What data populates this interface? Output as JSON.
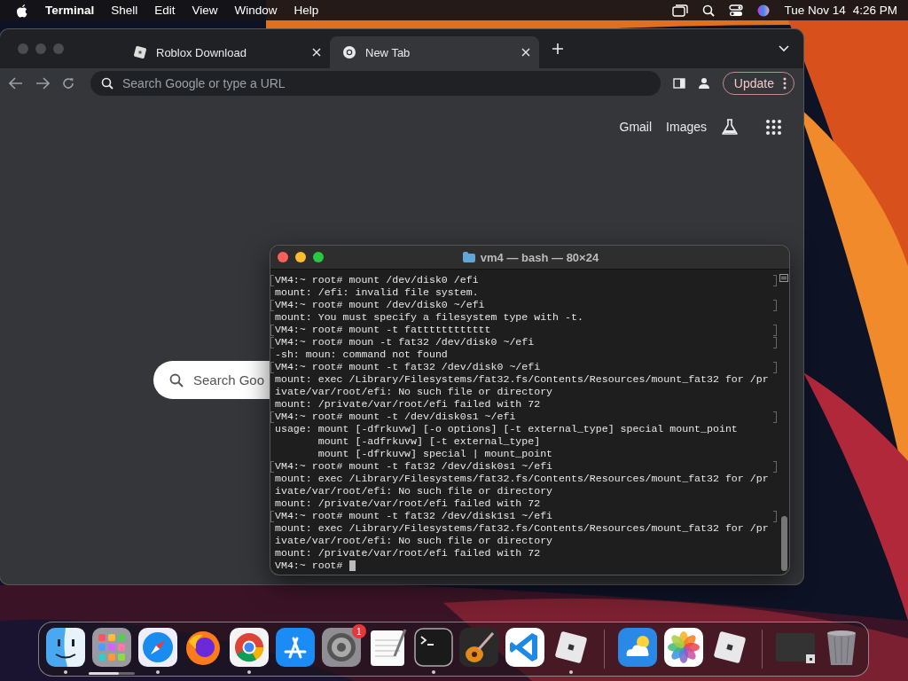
{
  "menu_bar": {
    "app": "Terminal",
    "items": [
      "Shell",
      "Edit",
      "View",
      "Window",
      "Help"
    ],
    "date": "Tue Nov 14",
    "time": "4:26 PM"
  },
  "browser": {
    "tabs": [
      {
        "label": "Roblox Download",
        "kind": "site",
        "selected": false
      },
      {
        "label": "New Tab",
        "kind": "newtab",
        "selected": true
      }
    ],
    "address_placeholder": "Search Google or type a URL",
    "update_button": "Update",
    "links": [
      "Gmail",
      "Images"
    ],
    "search_placeholder": "Search Goo"
  },
  "terminal": {
    "title": "vm4 — bash — 80×24",
    "lines": [
      {
        "kind": "command",
        "text": "VM4:~ root# mount /dev/disk0 /efi"
      },
      {
        "kind": "output",
        "text": "mount: /efi: invalid file system."
      },
      {
        "kind": "command",
        "text": "VM4:~ root# mount /dev/disk0 ~/efi"
      },
      {
        "kind": "output",
        "text": "mount: You must specify a filesystem type with -t."
      },
      {
        "kind": "command",
        "text": "VM4:~ root# mount -t fatttttttttttt"
      },
      {
        "kind": "command",
        "text": "VM4:~ root# moun -t fat32 /dev/disk0 ~/efi"
      },
      {
        "kind": "output",
        "text": "-sh: moun: command not found"
      },
      {
        "kind": "command",
        "text": "VM4:~ root# mount -t fat32 /dev/disk0 ~/efi"
      },
      {
        "kind": "output",
        "text": "mount: exec /Library/Filesystems/fat32.fs/Contents/Resources/mount_fat32 for /pr"
      },
      {
        "kind": "output",
        "text": "ivate/var/root/efi: No such file or directory"
      },
      {
        "kind": "output",
        "text": "mount: /private/var/root/efi failed with 72"
      },
      {
        "kind": "command",
        "text": "VM4:~ root# mount -t /dev/disk0s1 ~/efi"
      },
      {
        "kind": "output",
        "text": "usage: mount [-dfrkuvw] [-o options] [-t external_type] special mount_point"
      },
      {
        "kind": "output",
        "text": "       mount [-adfrkuvw] [-t external_type]"
      },
      {
        "kind": "output",
        "text": "       mount [-dfrkuvw] special | mount_point"
      },
      {
        "kind": "command",
        "text": "VM4:~ root# mount -t fat32 /dev/disk0s1 ~/efi"
      },
      {
        "kind": "output",
        "text": "mount: exec /Library/Filesystems/fat32.fs/Contents/Resources/mount_fat32 for /pr"
      },
      {
        "kind": "output",
        "text": "ivate/var/root/efi: No such file or directory"
      },
      {
        "kind": "output",
        "text": "mount: /private/var/root/efi failed with 72"
      },
      {
        "kind": "command",
        "text": "VM4:~ root# mount -t fat32 /dev/disk1s1 ~/efi"
      },
      {
        "kind": "output",
        "text": "mount: exec /Library/Filesystems/fat32.fs/Contents/Resources/mount_fat32 for /pr"
      },
      {
        "kind": "output",
        "text": "ivate/var/root/efi: No such file or directory"
      },
      {
        "kind": "output",
        "text": "mount: /private/var/root/efi failed with 72"
      },
      {
        "kind": "prompt",
        "text": "VM4:~ root#"
      }
    ]
  },
  "dock": {
    "items": [
      {
        "kind": "finder",
        "running": true
      },
      {
        "kind": "launchpad",
        "running": false,
        "level": 0.65
      },
      {
        "kind": "safari",
        "running": true
      },
      {
        "kind": "firefox",
        "running": false
      },
      {
        "kind": "chrome",
        "running": true
      },
      {
        "kind": "appstore",
        "running": false
      },
      {
        "kind": "settings",
        "running": false,
        "badge": "1"
      },
      {
        "kind": "textedit",
        "running": false
      },
      {
        "kind": "terminal",
        "running": true
      },
      {
        "kind": "garageband",
        "running": false
      },
      {
        "kind": "vscode",
        "running": false
      },
      {
        "kind": "roblox",
        "running": true
      },
      {
        "kind": "separator"
      },
      {
        "kind": "weather",
        "running": false
      },
      {
        "kind": "photos",
        "running": false
      },
      {
        "kind": "roblox",
        "running": false
      },
      {
        "kind": "separator"
      },
      {
        "kind": "window",
        "running": false
      },
      {
        "kind": "trash",
        "running": false
      }
    ]
  }
}
